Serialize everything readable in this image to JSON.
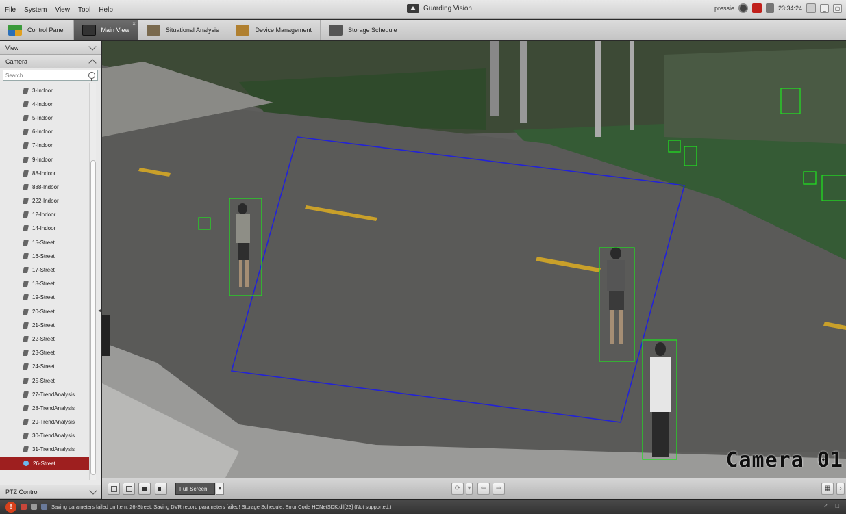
{
  "menu": [
    "File",
    "System",
    "View",
    "Tool",
    "Help"
  ],
  "app": {
    "title": "Guarding Vision"
  },
  "status": {
    "user": "pressie",
    "time": "23:34:24"
  },
  "tabs": [
    {
      "label": "Control Panel",
      "icon": "control-panel-icon",
      "active": false
    },
    {
      "label": "Main View",
      "icon": "main-view-icon",
      "active": true
    },
    {
      "label": "Situational Analysis",
      "icon": "situational-analysis-icon",
      "active": false
    },
    {
      "label": "Device Management",
      "icon": "device-management-icon",
      "active": false
    },
    {
      "label": "Storage Schedule",
      "icon": "storage-schedule-icon",
      "active": false
    }
  ],
  "sidebar": {
    "view_label": "View",
    "camera_label": "Camera",
    "search_placeholder": "Search...",
    "ptz_label": "PTZ Control",
    "cameras": [
      "3-Indoor",
      "4-Indoor",
      "5-Indoor",
      "6-Indoor",
      "7-Indoor",
      "9-Indoor",
      "88-Indoor",
      "888-Indoor",
      "222-Indoor",
      "12-Indoor",
      "14-Indoor",
      "15-Street",
      "16-Street",
      "17-Street",
      "18-Street",
      "19-Street",
      "20-Street",
      "21-Street",
      "22-Street",
      "23-Street",
      "24-Street",
      "25-Street",
      "27-TrendAnalysis",
      "28-TrendAnalysis",
      "29-TrendAnalysis",
      "30-TrendAnalysis",
      "31-TrendAnalysis",
      "26-Street"
    ],
    "selected_camera": "26-Street"
  },
  "video": {
    "osd_text": "Camera 01",
    "region_color": "#2020d0",
    "detection_color": "#22dd22"
  },
  "toolbar": {
    "display_mode": "Full Screen"
  },
  "statusbar": {
    "message": "Saving parameters failed on Item: 26-Street: Saving DVR record parameters failed! Storage Schedule: Error Code HCNetSDK.dll[23] (Not supported.)"
  }
}
